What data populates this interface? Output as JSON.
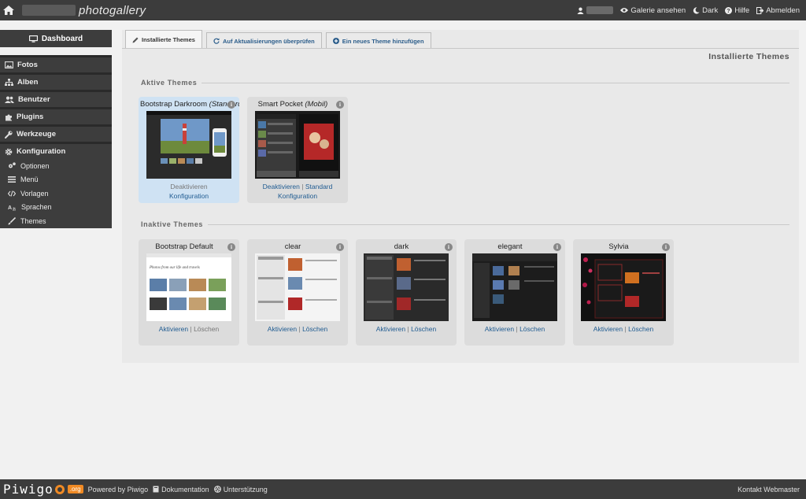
{
  "topbar": {
    "brand": "photogallery",
    "links": [
      {
        "label": "Galerie ansehen",
        "icon": "eye-icon"
      },
      {
        "label": "Dark",
        "icon": "moon-icon"
      },
      {
        "label": "Hilfe",
        "icon": "help-icon"
      },
      {
        "label": "Abmelden",
        "icon": "logout-icon"
      }
    ]
  },
  "sidebar": {
    "dashboard": "Dashboard",
    "items": [
      {
        "label": "Fotos",
        "icon": "image-icon"
      },
      {
        "label": "Alben",
        "icon": "sitemap-icon"
      },
      {
        "label": "Benutzer",
        "icon": "users-icon"
      },
      {
        "label": "Plugins",
        "icon": "puzzle-icon"
      },
      {
        "label": "Werkzeuge",
        "icon": "wrench-icon"
      },
      {
        "label": "Konfiguration",
        "icon": "cog-icon"
      }
    ],
    "subitems": [
      {
        "label": "Optionen",
        "icon": "cogs-icon"
      },
      {
        "label": "Menü",
        "icon": "menu-icon"
      },
      {
        "label": "Vorlagen",
        "icon": "code-icon"
      },
      {
        "label": "Sprachen",
        "icon": "language-icon"
      },
      {
        "label": "Themes",
        "icon": "brush-icon"
      }
    ]
  },
  "tabs": [
    {
      "label": "Installierte Themes",
      "icon": "pencil-icon",
      "active": true
    },
    {
      "label": "Auf Aktualisierungen überprüfen",
      "icon": "refresh-icon",
      "active": false
    },
    {
      "label": "Ein neues Theme hinzufügen",
      "icon": "plus-circle-icon",
      "active": false
    }
  ],
  "page_title": "Installierte Themes",
  "active_section": "Aktive Themes",
  "inactive_section": "Inaktive Themes",
  "active_themes": [
    {
      "name": "Bootstrap Darkroom",
      "tag": "(Standard)",
      "action1": "Deaktivieren",
      "action2": "Konfiguration",
      "is_default": true
    },
    {
      "name": "Smart Pocket",
      "tag": "(Mobil)",
      "action1": "Deaktivieren",
      "sep": "|",
      "action1b": "Standard",
      "action2": "Konfiguration"
    }
  ],
  "inactive_themes": [
    {
      "name": "Bootstrap Default",
      "action1": "Aktivieren",
      "sep": "|",
      "action2": "Löschen",
      "delete_disabled": true
    },
    {
      "name": "clear",
      "action1": "Aktivieren",
      "sep": "|",
      "action2": "Löschen"
    },
    {
      "name": "dark",
      "action1": "Aktivieren",
      "sep": "|",
      "action2": "Löschen"
    },
    {
      "name": "elegant",
      "action1": "Aktivieren",
      "sep": "|",
      "action2": "Löschen"
    },
    {
      "name": "Sylvia",
      "action1": "Aktivieren",
      "sep": "|",
      "action2": "Löschen"
    }
  ],
  "bd_caption": "Photos from our life and travels",
  "footer": {
    "logo": "Piwigo",
    "logo_badge": ".org",
    "powered": "Powered by Piwigo",
    "docs": "Dokumentation",
    "support": "Unterstützung",
    "contact": "Kontakt Webmaster"
  }
}
